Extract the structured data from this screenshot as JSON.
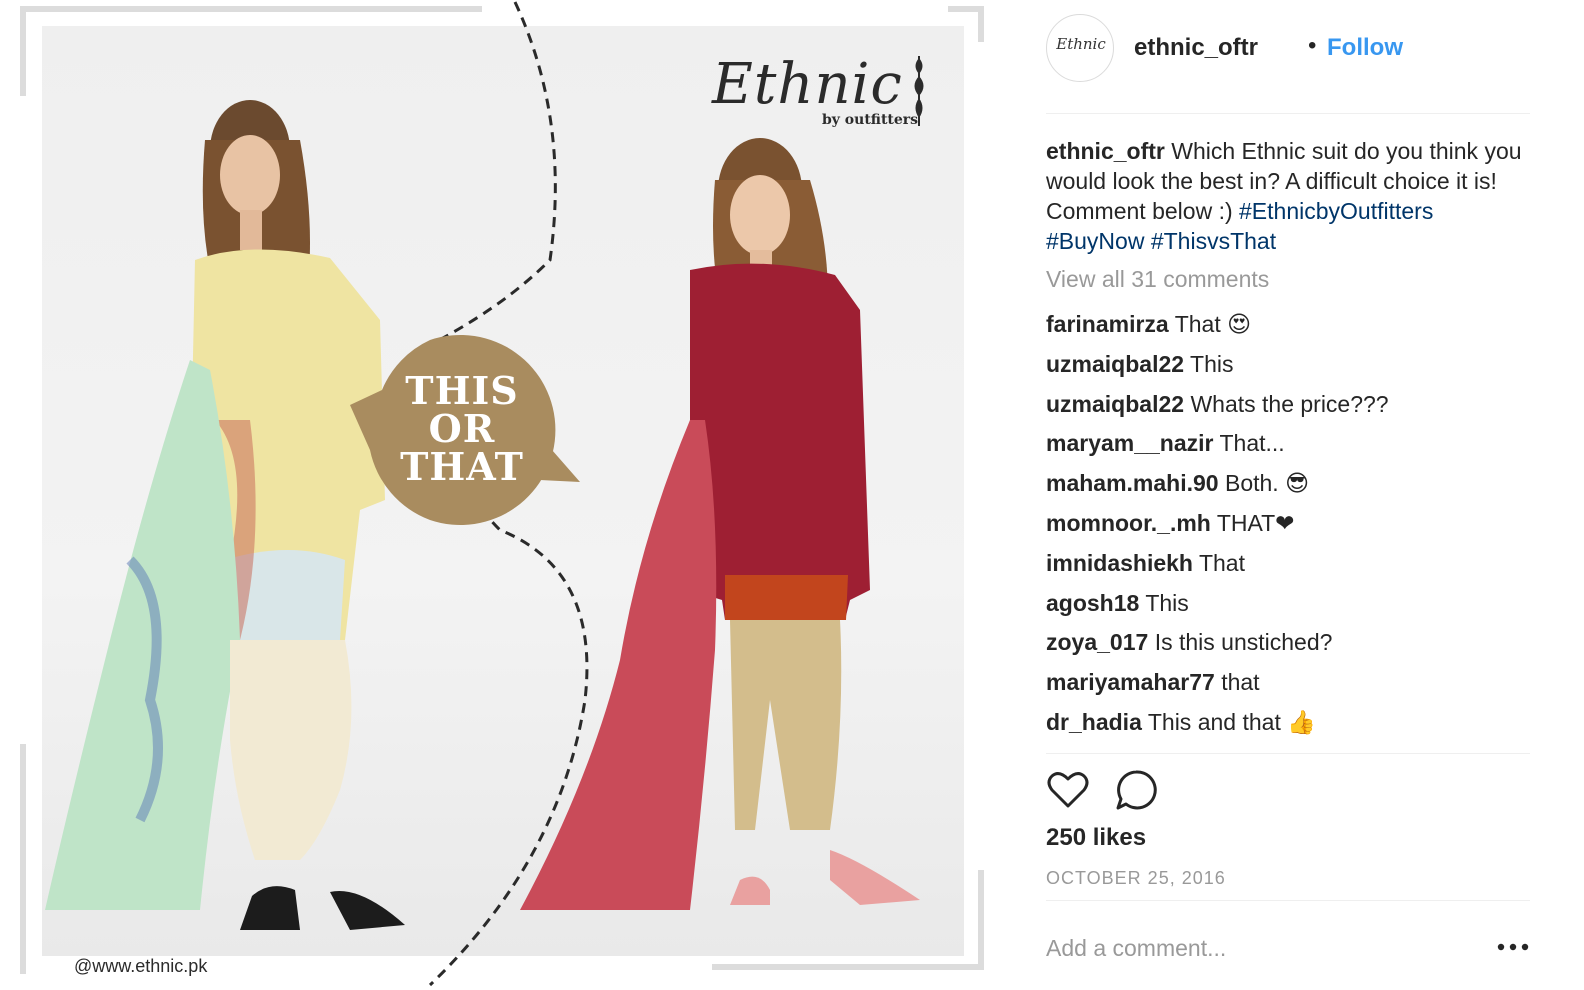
{
  "post_image": {
    "brand_script": "Ethnic",
    "brand_sub": "by outfitters",
    "bubble_lines": [
      "THIS",
      "OR",
      "THAT"
    ],
    "site_credit": "@www.ethnic.pk",
    "colors": {
      "bubble": "#a98c5f",
      "left_outfit": "#efe4a2",
      "right_outfit": "#9e1f33",
      "right_dupatta": "#c94b59",
      "left_dupatta": "#bfe4c8"
    }
  },
  "header": {
    "avatar_mark": "Ethnic",
    "username": "ethnic_oftr",
    "separator": "•",
    "follow_label": "Follow"
  },
  "caption": {
    "username": "ethnic_oftr",
    "text": "Which Ethnic suit do you think you would look the best in? A difficult choice it is! Comment below :)",
    "hashtags": [
      "#EthnicbyOutfitters",
      "#BuyNow",
      "#ThisvsThat"
    ]
  },
  "view_all_comments": "View all 31 comments",
  "comments": [
    {
      "user": "farinamirza",
      "text": "That 😍"
    },
    {
      "user": "uzmaiqbal22",
      "text": "This"
    },
    {
      "user": "uzmaiqbal22",
      "text": "Whats the price???"
    },
    {
      "user": "maryam__nazir",
      "text": "That..."
    },
    {
      "user": "maham.mahi.90",
      "text": "Both. 😎"
    },
    {
      "user": "momnoor._.mh",
      "text": "THAT❤"
    },
    {
      "user": "imnidashiekh",
      "text": "That"
    },
    {
      "user": "agosh18",
      "text": "This"
    },
    {
      "user": "zoya_017",
      "text": "Is this unstiched?"
    },
    {
      "user": "mariyamahar77",
      "text": "that"
    },
    {
      "user": "dr_hadia",
      "text": "This and that 👍"
    }
  ],
  "actions": {
    "like_icon": "heart-outline",
    "comment_icon": "speech-bubble-outline",
    "more_icon": "ellipsis"
  },
  "likes": "250 likes",
  "date": "OCTOBER 25, 2016",
  "add_comment_placeholder": "Add a comment...",
  "more_label": "•••"
}
